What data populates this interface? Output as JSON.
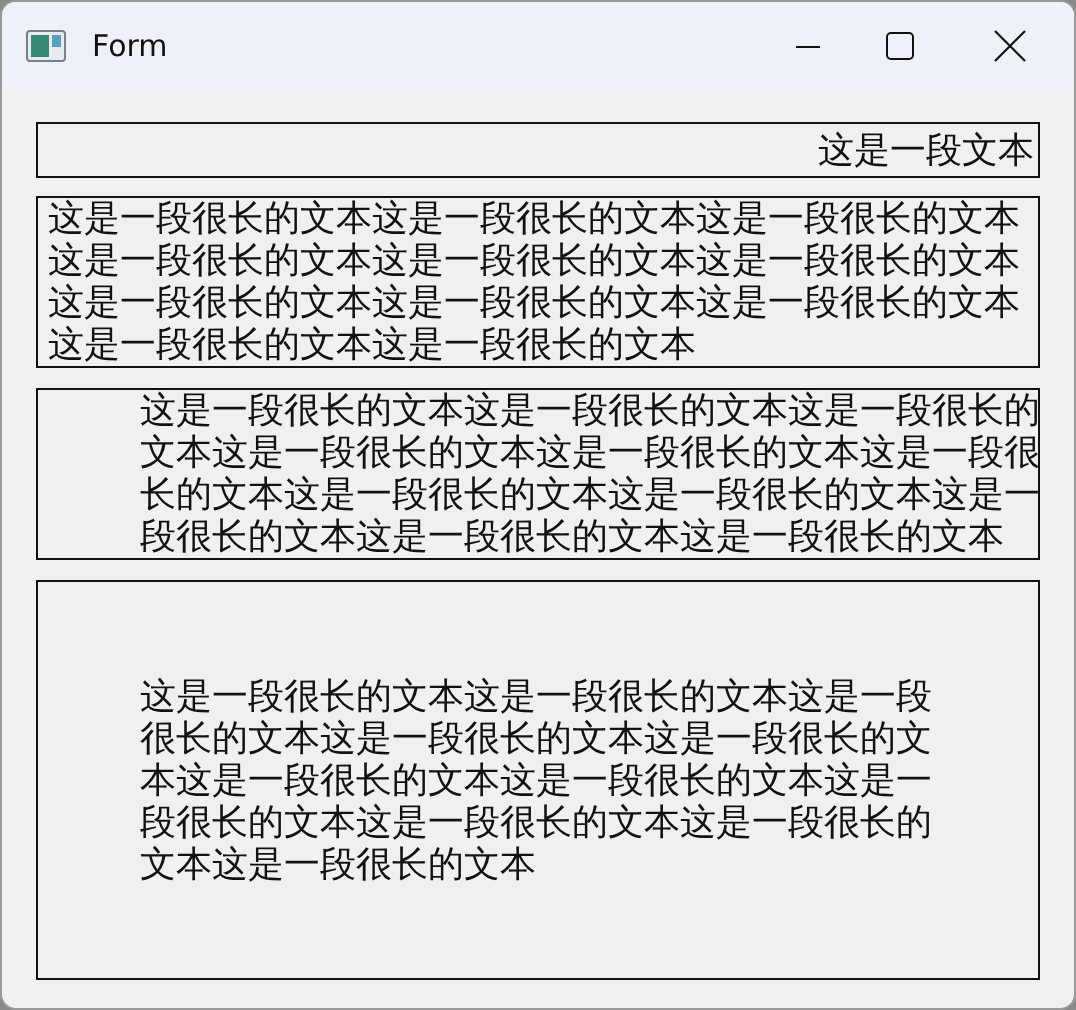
{
  "window": {
    "title": "Form"
  },
  "labels": [
    {
      "kind": "single-right",
      "text": "这是一段文本"
    },
    {
      "kind": "wrap-left",
      "text": "这是一段很长的文本这是一段很长的文本这是一段很长的文本这是一段很长的文本这是一段很长的文本这是一段很长的文本这是一段很长的文本这是一段很长的文本这是一段很长的文本这是一段很长的文本这是一段很长的文本"
    },
    {
      "kind": "wrap-indent",
      "text": "这是一段很长的文本这是一段很长的文本这是一段很长的文本这是一段很长的文本这是一段很长的文本这是一段很长的文本这是一段很长的文本这是一段很长的文本这是一段很长的文本这是一段很长的文本这是一段很长的文本"
    },
    {
      "kind": "wrap-centered",
      "text": "这是一段很长的文本这是一段很长的文本这是一段很长的文本这是一段很长的文本这是一段很长的文本这是一段很长的文本这是一段很长的文本这是一段很长的文本这是一段很长的文本这是一段很长的文本这是一段很长的文本"
    }
  ]
}
